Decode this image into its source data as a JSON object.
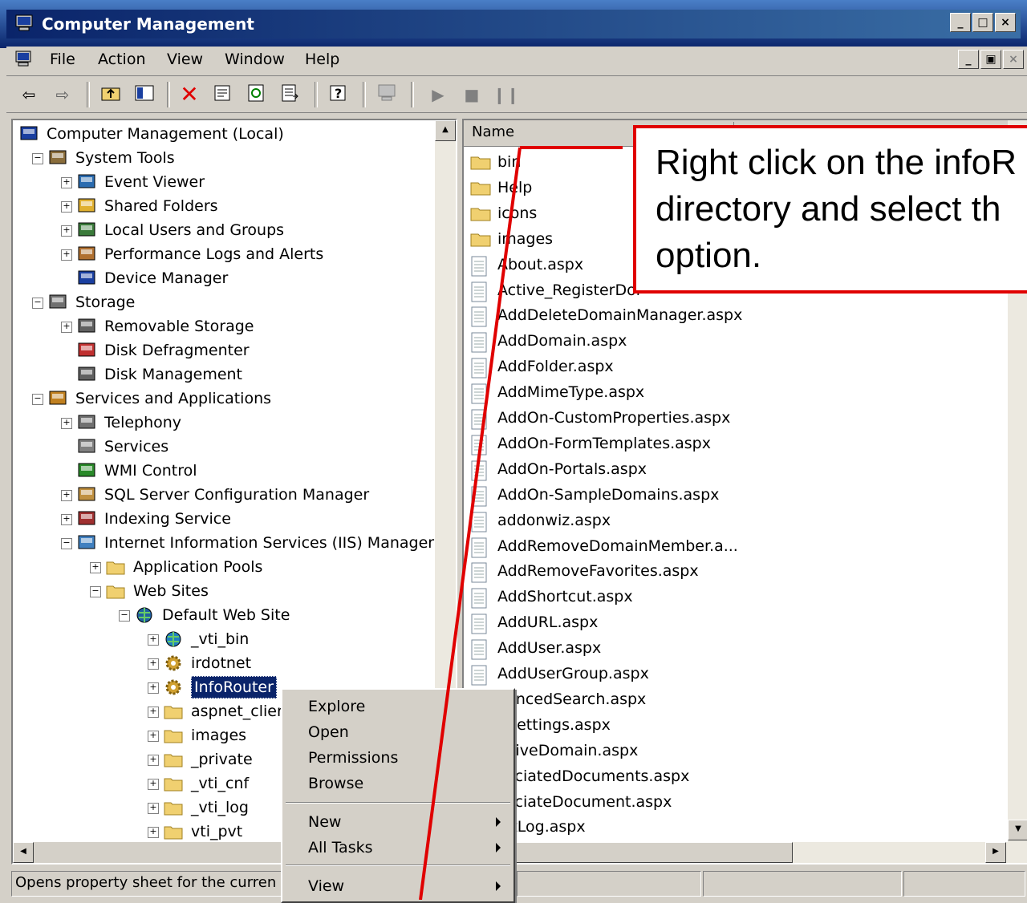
{
  "window": {
    "title": "Computer Management",
    "controls": [
      "_",
      "□",
      "×"
    ],
    "mdi_controls": [
      "_",
      "▣",
      "×"
    ]
  },
  "menubar": {
    "items": [
      "File",
      "Action",
      "View",
      "Window",
      "Help"
    ]
  },
  "toolbar": {
    "icons": [
      "back-arrow-icon",
      "forward-arrow-icon",
      "up-folder-icon",
      "show-hide-tree-icon",
      "delete-icon",
      "properties-icon",
      "refresh-icon",
      "export-list-icon",
      "help-icon",
      "computer-icon",
      "play-icon",
      "stop-icon",
      "pause-icon"
    ]
  },
  "tree": {
    "items": [
      {
        "label": "Computer Management (Local)",
        "level": 0,
        "expander": "",
        "icon": "computer-icon"
      },
      {
        "label": "System Tools",
        "level": 1,
        "expander": "−",
        "icon": "tools-icon"
      },
      {
        "label": "Event Viewer",
        "level": 2,
        "expander": "+",
        "icon": "event-viewer-icon"
      },
      {
        "label": "Shared Folders",
        "level": 2,
        "expander": "+",
        "icon": "shared-folder-icon"
      },
      {
        "label": "Local Users and Groups",
        "level": 2,
        "expander": "+",
        "icon": "users-icon"
      },
      {
        "label": "Performance Logs and Alerts",
        "level": 2,
        "expander": "+",
        "icon": "performance-icon"
      },
      {
        "label": "Device Manager",
        "level": 2,
        "expander": "",
        "icon": "device-manager-icon"
      },
      {
        "label": "Storage",
        "level": 1,
        "expander": "−",
        "icon": "storage-icon"
      },
      {
        "label": "Removable Storage",
        "level": 2,
        "expander": "+",
        "icon": "removable-storage-icon"
      },
      {
        "label": "Disk Defragmenter",
        "level": 2,
        "expander": "",
        "icon": "defrag-icon"
      },
      {
        "label": "Disk Management",
        "level": 2,
        "expander": "",
        "icon": "disk-management-icon"
      },
      {
        "label": "Services and Applications",
        "level": 1,
        "expander": "−",
        "icon": "services-apps-icon"
      },
      {
        "label": "Telephony",
        "level": 2,
        "expander": "+",
        "icon": "telephony-icon"
      },
      {
        "label": "Services",
        "level": 2,
        "expander": "",
        "icon": "services-icon"
      },
      {
        "label": "WMI Control",
        "level": 2,
        "expander": "",
        "icon": "wmi-icon"
      },
      {
        "label": "SQL Server Configuration Manager",
        "level": 2,
        "expander": "+",
        "icon": "sql-icon"
      },
      {
        "label": "Indexing Service",
        "level": 2,
        "expander": "+",
        "icon": "indexing-icon"
      },
      {
        "label": "Internet Information Services (IIS) Manager",
        "level": 2,
        "expander": "−",
        "icon": "iis-icon"
      },
      {
        "label": "Application Pools",
        "level": 3,
        "expander": "+",
        "icon": "folder-icon"
      },
      {
        "label": "Web Sites",
        "level": 3,
        "expander": "−",
        "icon": "folder-icon"
      },
      {
        "label": "Default Web Site",
        "level": 4,
        "expander": "−",
        "icon": "globe-icon"
      },
      {
        "label": "_vti_bin",
        "level": 5,
        "expander": "+",
        "icon": "globe-small-icon"
      },
      {
        "label": "irdotnet",
        "level": 5,
        "expander": "+",
        "icon": "gear-icon"
      },
      {
        "label": "InfoRouter",
        "level": 5,
        "expander": "+",
        "icon": "gear-icon",
        "selected": true
      },
      {
        "label": "aspnet_clier",
        "level": 5,
        "expander": "+",
        "icon": "folder-icon"
      },
      {
        "label": "images",
        "level": 5,
        "expander": "+",
        "icon": "folder-icon"
      },
      {
        "label": "_private",
        "level": 5,
        "expander": "+",
        "icon": "folder-icon"
      },
      {
        "label": "_vti_cnf",
        "level": 5,
        "expander": "+",
        "icon": "folder-icon"
      },
      {
        "label": "_vti_log",
        "level": 5,
        "expander": "+",
        "icon": "folder-icon"
      },
      {
        "label": "vti_pvt",
        "level": 5,
        "expander": "+",
        "icon": "folder-icon"
      }
    ]
  },
  "list": {
    "column_name": "Name",
    "items": [
      {
        "name": "bin",
        "type": "folder"
      },
      {
        "name": "Help",
        "type": "folder"
      },
      {
        "name": "icons",
        "type": "folder"
      },
      {
        "name": "images",
        "type": "folder"
      },
      {
        "name": "About.aspx",
        "type": "file"
      },
      {
        "name": "Active_RegisterDor",
        "type": "file"
      },
      {
        "name": "AddDeleteDomainManager.aspx",
        "type": "file"
      },
      {
        "name": "AddDomain.aspx",
        "type": "file"
      },
      {
        "name": "AddFolder.aspx",
        "type": "file"
      },
      {
        "name": "AddMimeType.aspx",
        "type": "file"
      },
      {
        "name": "AddOn-CustomProperties.aspx",
        "type": "file"
      },
      {
        "name": "AddOn-FormTemplates.aspx",
        "type": "file"
      },
      {
        "name": "AddOn-Portals.aspx",
        "type": "file"
      },
      {
        "name": "AddOn-SampleDomains.aspx",
        "type": "file"
      },
      {
        "name": "addonwiz.aspx",
        "type": "file"
      },
      {
        "name": "AddRemoveDomainMember.a...",
        "type": "file"
      },
      {
        "name": "AddRemoveFavorites.aspx",
        "type": "file"
      },
      {
        "name": "AddShortcut.aspx",
        "type": "file"
      },
      {
        "name": "AddURL.aspx",
        "type": "file"
      },
      {
        "name": "AddUser.aspx",
        "type": "file"
      },
      {
        "name": "AddUserGroup.aspx",
        "type": "file"
      },
      {
        "name": "vancedSearch.aspx",
        "type": "file"
      },
      {
        "name": "pSettings.aspx",
        "type": "file"
      },
      {
        "name": "chiveDomain.aspx",
        "type": "file"
      },
      {
        "name": "sociatedDocuments.aspx",
        "type": "file"
      },
      {
        "name": "sociateDocument.aspx",
        "type": "file"
      },
      {
        "name": "ditLog.aspx",
        "type": "file"
      }
    ]
  },
  "context_menu": {
    "items": [
      {
        "label": "Explore",
        "submenu": false
      },
      {
        "label": "Open",
        "submenu": false
      },
      {
        "label": "Permissions",
        "submenu": false
      },
      {
        "label": "Browse",
        "submenu": false
      },
      {
        "label": "New",
        "submenu": true
      },
      {
        "label": "All Tasks",
        "submenu": true
      },
      {
        "label": "View",
        "submenu": true
      }
    ]
  },
  "status": {
    "text": "Opens property sheet for the curren"
  },
  "callout": {
    "text": "Right click on the infoR\ndirectory and select th\noption."
  },
  "colors": {
    "selection": "#0a246a",
    "callout_border": "#e00000",
    "title_bar": "#0a246a"
  }
}
